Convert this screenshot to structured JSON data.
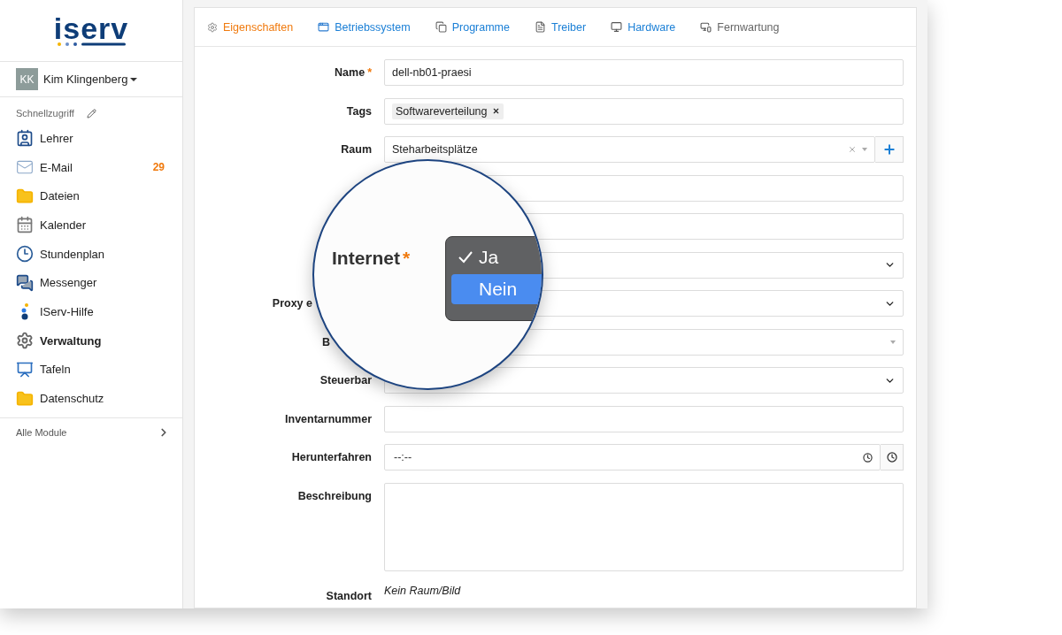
{
  "logo": {
    "text": "iserv"
  },
  "user": {
    "initials": "KK",
    "name": "Kim Klingenberg"
  },
  "sidebar": {
    "section": "Schnellzugriff",
    "items": [
      {
        "label": "Lehrer",
        "selected": false
      },
      {
        "label": "E-Mail",
        "badge": "29",
        "selected": false
      },
      {
        "label": "Dateien",
        "selected": false
      },
      {
        "label": "Kalender",
        "selected": false
      },
      {
        "label": "Stundenplan",
        "selected": false
      },
      {
        "label": "Messenger",
        "selected": false
      },
      {
        "label": "IServ-Hilfe",
        "selected": false
      },
      {
        "label": "Verwaltung",
        "selected": true
      },
      {
        "label": "Tafeln",
        "selected": false
      },
      {
        "label": "Datenschutz",
        "selected": false
      }
    ],
    "footer": "Alle Module"
  },
  "tabs": [
    {
      "label": "Eigenschaften",
      "selected": true,
      "disabled": false
    },
    {
      "label": "Betriebssystem",
      "selected": false,
      "disabled": false
    },
    {
      "label": "Programme",
      "selected": false,
      "disabled": false
    },
    {
      "label": "Treiber",
      "selected": false,
      "disabled": false
    },
    {
      "label": "Hardware",
      "selected": false,
      "disabled": false
    },
    {
      "label": "Fernwartung",
      "selected": false,
      "disabled": true
    }
  ],
  "form": {
    "rows": [
      {
        "kind": "text",
        "label": "Name",
        "marker": "*",
        "value": "dell-nb01-praesi"
      },
      {
        "kind": "tags",
        "label": "Tags",
        "tags": [
          "Softwareverteilung"
        ]
      },
      {
        "kind": "combo",
        "label": "Raum",
        "value": "Steharbeitsplätze"
      },
      {
        "kind": "text"
      },
      {
        "kind": "text"
      },
      {
        "kind": "select"
      },
      {
        "kind": "select",
        "label": "Proxy e"
      },
      {
        "kind": "combo",
        "label": "B"
      },
      {
        "kind": "select",
        "label": "Steuerbar"
      },
      {
        "kind": "text",
        "label": "Inventarnummer"
      },
      {
        "kind": "time",
        "label": "Herunterfahren",
        "placeholder": "--:--"
      },
      {
        "kind": "textarea",
        "label": "Beschreibung"
      },
      {
        "kind": "static",
        "label": "Standort",
        "value": "Kein Raum/Bild"
      }
    ]
  },
  "magnifier": {
    "label": "Internet",
    "marker": "*",
    "options": [
      {
        "label": "Ja",
        "checked": true,
        "selected": false
      },
      {
        "label": "Nein",
        "checked": false,
        "selected": true
      }
    ]
  }
}
